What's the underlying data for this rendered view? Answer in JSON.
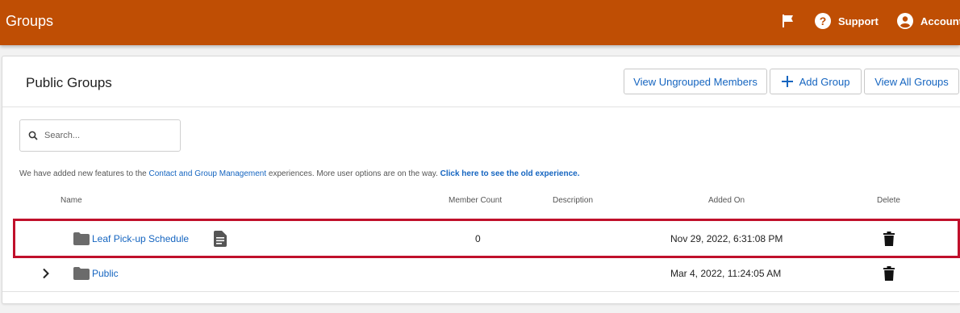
{
  "header": {
    "title": "Groups",
    "support_label": "Support",
    "account_label": "Account",
    "icons": [
      "flag-icon",
      "help-circle-icon",
      "account-circle-icon"
    ],
    "bg_color": "#bf4e04"
  },
  "panel": {
    "title": "Public Groups",
    "buttons": {
      "ungrouped": "View Ungrouped Members",
      "add_group": "Add Group",
      "view_all": "View All Groups"
    }
  },
  "search": {
    "placeholder": "Search..."
  },
  "notice": {
    "pre": "We have added new features to the ",
    "link1": "Contact and Group Management",
    "mid": " experiences. More user options are on the way. ",
    "link2": "Click here to see the old experience."
  },
  "table": {
    "columns": [
      "Name",
      "Member Count",
      "Description",
      "Added On",
      "Delete"
    ],
    "rows": [
      {
        "name": "Leaf Pick-up Schedule",
        "member_count": "0",
        "description": "",
        "added_on": "Nov 29, 2022, 6:31:08 PM"
      },
      {
        "name": "Public",
        "member_count": "",
        "description": "",
        "added_on": "Mar 4, 2022, 11:24:05 AM"
      }
    ]
  },
  "colors": {
    "link": "#1565c0",
    "highlight": "#c0102b"
  }
}
